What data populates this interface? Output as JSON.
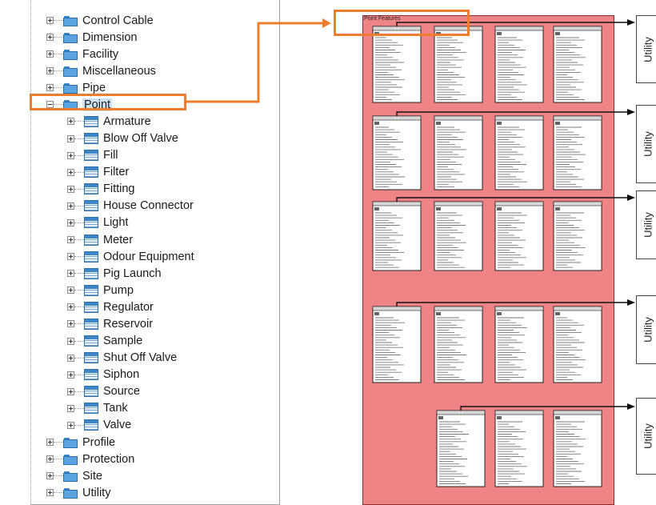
{
  "tree": [
    {
      "label": "Control Cable",
      "type": "folder",
      "level": 0,
      "expanded": false
    },
    {
      "label": "Dimension",
      "type": "folder",
      "level": 0,
      "expanded": false
    },
    {
      "label": "Facility",
      "type": "folder",
      "level": 0,
      "expanded": false
    },
    {
      "label": "Miscellaneous",
      "type": "folder",
      "level": 0,
      "expanded": false
    },
    {
      "label": "Pipe",
      "type": "folder",
      "level": 0,
      "expanded": false
    },
    {
      "label": "Point",
      "type": "folder",
      "level": 0,
      "expanded": true,
      "highlighted": true
    },
    {
      "label": "Armature",
      "type": "table",
      "level": 1,
      "expanded": false
    },
    {
      "label": "Blow Off Valve",
      "type": "table",
      "level": 1,
      "expanded": false
    },
    {
      "label": "Fill",
      "type": "table",
      "level": 1,
      "expanded": false
    },
    {
      "label": "Filter",
      "type": "table",
      "level": 1,
      "expanded": false
    },
    {
      "label": "Fitting",
      "type": "table",
      "level": 1,
      "expanded": false
    },
    {
      "label": "House Connector",
      "type": "table",
      "level": 1,
      "expanded": false
    },
    {
      "label": "Light",
      "type": "table",
      "level": 1,
      "expanded": false
    },
    {
      "label": "Meter",
      "type": "table",
      "level": 1,
      "expanded": false
    },
    {
      "label": "Odour Equipment",
      "type": "table",
      "level": 1,
      "expanded": false
    },
    {
      "label": "Pig Launch",
      "type": "table",
      "level": 1,
      "expanded": false
    },
    {
      "label": "Pump",
      "type": "table",
      "level": 1,
      "expanded": false
    },
    {
      "label": "Regulator",
      "type": "table",
      "level": 1,
      "expanded": false
    },
    {
      "label": "Reservoir",
      "type": "table",
      "level": 1,
      "expanded": false
    },
    {
      "label": "Sample",
      "type": "table",
      "level": 1,
      "expanded": false
    },
    {
      "label": "Shut Off Valve",
      "type": "table",
      "level": 1,
      "expanded": false
    },
    {
      "label": "Siphon",
      "type": "table",
      "level": 1,
      "expanded": false
    },
    {
      "label": "Source",
      "type": "table",
      "level": 1,
      "expanded": false
    },
    {
      "label": "Tank",
      "type": "table",
      "level": 1,
      "expanded": false
    },
    {
      "label": "Valve",
      "type": "table",
      "level": 1,
      "expanded": false
    },
    {
      "label": "Profile",
      "type": "folder",
      "level": 0,
      "expanded": false
    },
    {
      "label": "Protection",
      "type": "folder",
      "level": 0,
      "expanded": false
    },
    {
      "label": "Site",
      "type": "folder",
      "level": 0,
      "expanded": false
    },
    {
      "label": "Utility",
      "type": "folder",
      "level": 0,
      "expanded": false
    }
  ],
  "diagram": {
    "title": "Point Features",
    "rows": [
      {
        "tables": 4
      },
      {
        "tables": 4
      },
      {
        "tables": 4
      },
      {
        "tables": 4
      },
      {
        "tables": 3
      }
    ],
    "utility_labels": [
      "Utility",
      "Utility",
      "Utility",
      "Utility",
      "Utility"
    ]
  },
  "colors": {
    "highlight": "#ef7d2b",
    "diagram_background": "#ef8486",
    "folder_icon": "#5aa4e2"
  },
  "icons": {
    "expand": "plus-box-icon",
    "collapse": "minus-box-icon",
    "folder": "folder-icon",
    "table": "table-icon"
  }
}
